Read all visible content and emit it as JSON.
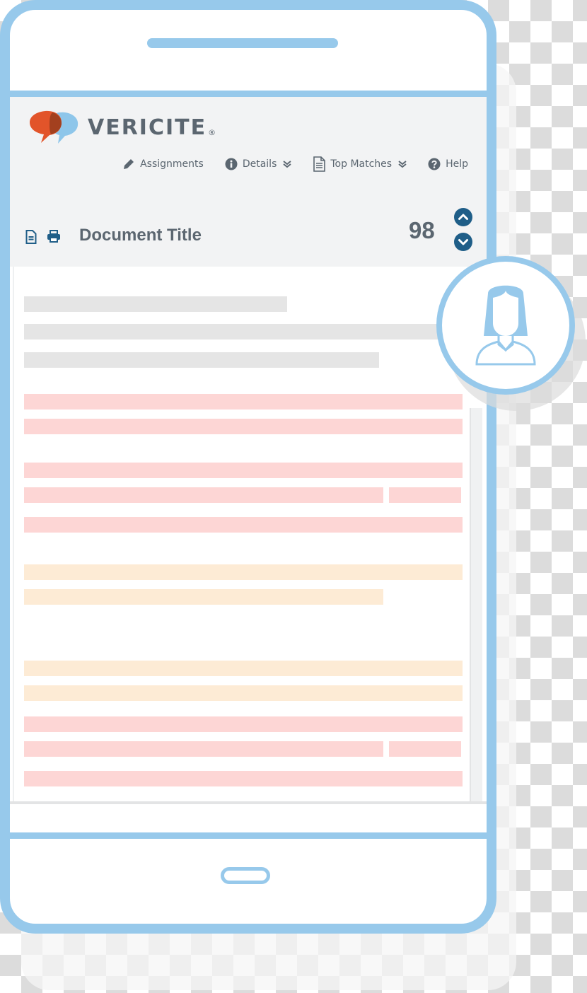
{
  "brand": {
    "name": "VERICITE",
    "registered_mark": "®",
    "logo_colors": {
      "bubble_left": "#e2542a",
      "bubble_right": "#8ec6ea",
      "overlap": "#a3401f"
    }
  },
  "nav": {
    "items": [
      {
        "label": "Assignments",
        "icon": "pencil-icon",
        "has_dropdown": false
      },
      {
        "label": "Details",
        "icon": "info-icon",
        "has_dropdown": true
      },
      {
        "label": "Top Matches",
        "icon": "document-icon",
        "has_dropdown": true
      },
      {
        "label": "Help",
        "icon": "question-icon",
        "has_dropdown": false
      }
    ],
    "dropdown_glyph": "»"
  },
  "document": {
    "title": "Document Title",
    "score": "98",
    "toolbar_icons": [
      "document-icon",
      "print-icon"
    ],
    "navigation": [
      "previous-match",
      "next-match"
    ]
  },
  "content_lines": [
    {
      "type": "text",
      "segments": [
        0.6
      ]
    },
    {
      "type": "text",
      "segments": [
        1.0
      ]
    },
    {
      "type": "text",
      "segments": [
        0.81
      ]
    },
    {
      "type": "match-high",
      "segments": [
        1.0
      ]
    },
    {
      "type": "match-high",
      "segments": [
        1.0
      ]
    },
    {
      "type": "match-high",
      "segments": [
        1.0
      ]
    },
    {
      "type": "match-high",
      "segments": [
        0.82,
        0.165
      ]
    },
    {
      "type": "match-high",
      "segments": [
        1.0
      ]
    },
    {
      "type": "match-medium",
      "segments": [
        1.0
      ]
    },
    {
      "type": "match-medium",
      "segments": [
        0.82
      ]
    },
    {
      "type": "match-medium",
      "segments": [
        1.0
      ]
    },
    {
      "type": "match-medium",
      "segments": [
        1.0
      ]
    },
    {
      "type": "match-high",
      "segments": [
        1.0
      ]
    },
    {
      "type": "match-high",
      "segments": [
        0.82,
        0.165
      ]
    },
    {
      "type": "match-high",
      "segments": [
        1.0
      ]
    }
  ],
  "colors": {
    "device_frame": "#97c9eb",
    "header_bg": "#f2f3f4",
    "text_gray": "#5b6670",
    "accent_blue": "#1f5e88",
    "match_high": "#fdd6d5",
    "match_medium": "#fdebd5",
    "text_placeholder": "#e5e5e5"
  },
  "user": {
    "avatar": "female-user-avatar"
  }
}
